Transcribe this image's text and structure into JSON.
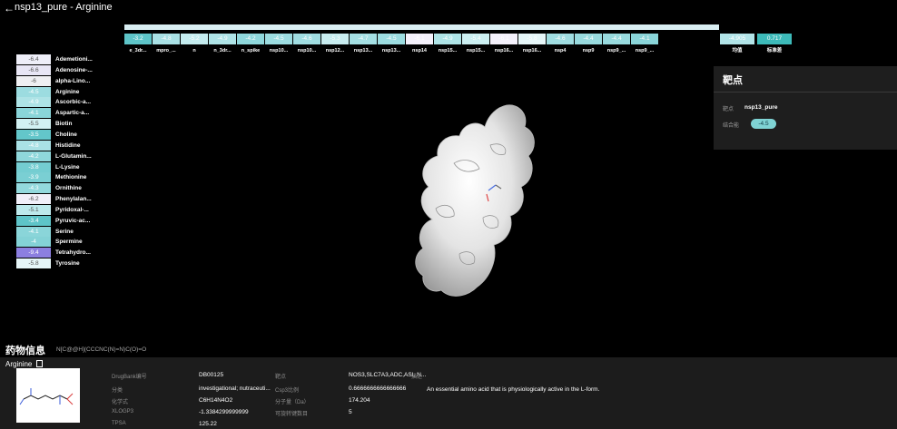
{
  "header": {
    "back_icon": "arrow-left-icon",
    "title": "nsp13_pure - Arginine"
  },
  "heatmap_row": [
    {
      "value": "-3.2",
      "label": "e_3dr...",
      "color": "#5ec4c8"
    },
    {
      "value": "-4.8",
      "label": "mpro_...",
      "color": "#a9e1e5"
    },
    {
      "value": "-5.2",
      "label": "n",
      "color": "#c4ecef"
    },
    {
      "value": "-4.9",
      "label": "n_3dr...",
      "color": "#aee3e6"
    },
    {
      "value": "-4.2",
      "label": "n_spike",
      "color": "#8fd7db"
    },
    {
      "value": "-4.5",
      "label": "nsp10...",
      "color": "#9cdce0"
    },
    {
      "value": "-4.6",
      "label": "nsp10...",
      "color": "#a0dde1"
    },
    {
      "value": "-5.3",
      "label": "nsp12...",
      "color": "#c8edf0"
    },
    {
      "value": "-4.7",
      "label": "nsp13...",
      "color": "#a4dfe3"
    },
    {
      "value": "-4.5",
      "label": "nsp13...",
      "color": "#9cdce0"
    },
    {
      "value": "-6.1",
      "label": "nsp14",
      "color": "#f4f1fb"
    },
    {
      "value": "-4.9",
      "label": "nsp15...",
      "color": "#aee3e6"
    },
    {
      "value": "-5.4",
      "label": "nsp15...",
      "color": "#ccf0f2"
    },
    {
      "value": "-6.1",
      "label": "nsp16...",
      "color": "#f4f1fb"
    },
    {
      "value": "-5.8",
      "label": "nsp16...",
      "color": "#e6f6f8"
    },
    {
      "value": "-4.6",
      "label": "nsp4",
      "color": "#a0dde1"
    },
    {
      "value": "-4.4",
      "label": "nsp9",
      "color": "#98dade"
    },
    {
      "value": "-4.4",
      "label": "nsp9_...",
      "color": "#98dade"
    },
    {
      "value": "-4.1",
      "label": "nsp9_...",
      "color": "#8ad5d9"
    }
  ],
  "summary": [
    {
      "value": "-4.905",
      "label": "均值",
      "color": "#b2e4e8"
    },
    {
      "value": "0.717",
      "label": "标准差",
      "color": "#3dbab9"
    }
  ],
  "drug_list": [
    {
      "value": "-6.4",
      "name": "Ademetioni...",
      "color": "#eeeef8"
    },
    {
      "value": "-6.6",
      "name": "Adenosine-...",
      "color": "#e8e6f5"
    },
    {
      "value": "-6",
      "name": "alpha-Lino...",
      "color": "#efeff2"
    },
    {
      "value": "-4.5",
      "name": "Arginine",
      "color": "#9cdce0"
    },
    {
      "value": "-4.9",
      "name": "Ascorbic-a...",
      "color": "#aee3e6"
    },
    {
      "value": "-4.1",
      "name": "Aspartic-a...",
      "color": "#8ad5d9"
    },
    {
      "value": "-5.5",
      "name": "Biotin",
      "color": "#d2f1f3"
    },
    {
      "value": "-3.5",
      "name": "Choline",
      "color": "#63c6ca"
    },
    {
      "value": "-4.8",
      "name": "Histidine",
      "color": "#a9e1e5"
    },
    {
      "value": "-4.2",
      "name": "L-Glutamin...",
      "color": "#8fd7db"
    },
    {
      "value": "-3.8",
      "name": "L-Lysine",
      "color": "#74cdd1"
    },
    {
      "value": "-3.9",
      "name": "Methionine",
      "color": "#7acfd3"
    },
    {
      "value": "-4.3",
      "name": "Ornithine",
      "color": "#93d9dd"
    },
    {
      "value": "-6.2",
      "name": "Phenylalan...",
      "color": "#f1eff9"
    },
    {
      "value": "-5.1",
      "name": "Pyridoxal-...",
      "color": "#bde9ec"
    },
    {
      "value": "-3.4",
      "name": "Pyruvic-ac...",
      "color": "#5ec4c8"
    },
    {
      "value": "-4.1",
      "name": "Serine",
      "color": "#8ad5d9"
    },
    {
      "value": "-4",
      "name": "Spermine",
      "color": "#84d2d6"
    },
    {
      "value": "-9.4",
      "name": "Tetrahydro...",
      "color": "#8c7fe0"
    },
    {
      "value": "-5.8",
      "name": "Tyrosine",
      "color": "#e6f6f8"
    }
  ],
  "target_panel": {
    "title": "靶点",
    "target_label": "靶点",
    "target_value": "nsp13_pure",
    "binding_label": "结合能",
    "binding_value": "-4.5",
    "badge_color": "#7fd3d4"
  },
  "drug_info": {
    "heading": "药物信息",
    "smiles": "N[C@@H](CCCNC(N)=N)C(O)=O",
    "name": "Arginine",
    "doc_icon": "document-icon",
    "structure_icon": "molecule-structure-icon",
    "fields_col1": [
      {
        "label": "DrugBank编号",
        "value": "DB00125"
      },
      {
        "label": "分类",
        "value": "investigational; nutraceuti..."
      },
      {
        "label": "化学式",
        "value": "C6H14N4O2"
      },
      {
        "label": "XLOGP3",
        "value": "-1.3384299999999"
      },
      {
        "label": "TPSA",
        "value": "125.22"
      }
    ],
    "fields_col2": [
      {
        "label": "靶点",
        "value": "NOS3,SLC7A3,ADC,ASL,N..."
      },
      {
        "label": "Csp3比例",
        "value": "0.6666666666666666"
      },
      {
        "label": "分子量（Da）",
        "value": "174.204"
      },
      {
        "label": "可旋转键数目",
        "value": "5"
      }
    ],
    "description_label": "描述",
    "description": "An essential amino acid that is physiologically active in the L-form."
  }
}
